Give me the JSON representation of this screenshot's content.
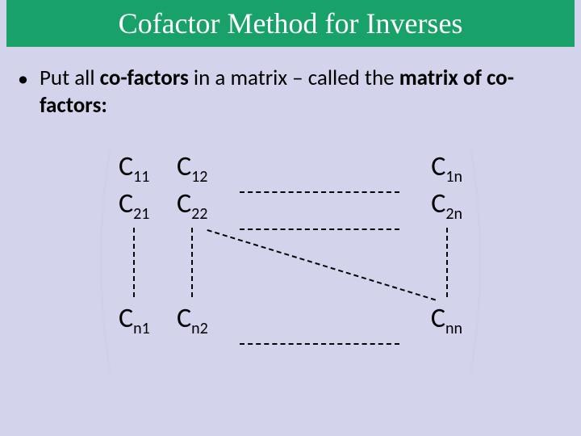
{
  "title": "Cofactor Method for Inverses",
  "bullet": {
    "part1": "Put all ",
    "bold1": "co-factors",
    "part2": " in a matrix – called the ",
    "bold2": "matrix of co-factors:"
  },
  "matrix": {
    "r1": {
      "c1_sym": "C",
      "c1_sub": "11",
      "c2_sym": "C",
      "c2_sub": "12",
      "cN_sym": "C",
      "cN_sub": "1n"
    },
    "r2": {
      "c1_sym": "C",
      "c1_sub": "21",
      "c2_sym": "C",
      "c2_sub": "22",
      "cN_sym": "C",
      "cN_sub": "2n"
    },
    "rN": {
      "c1_sym": "C",
      "c1_sub": "n1",
      "c2_sym": "C",
      "c2_sub": "n2",
      "cN_sym": "C",
      "cN_sub": "nn"
    }
  }
}
